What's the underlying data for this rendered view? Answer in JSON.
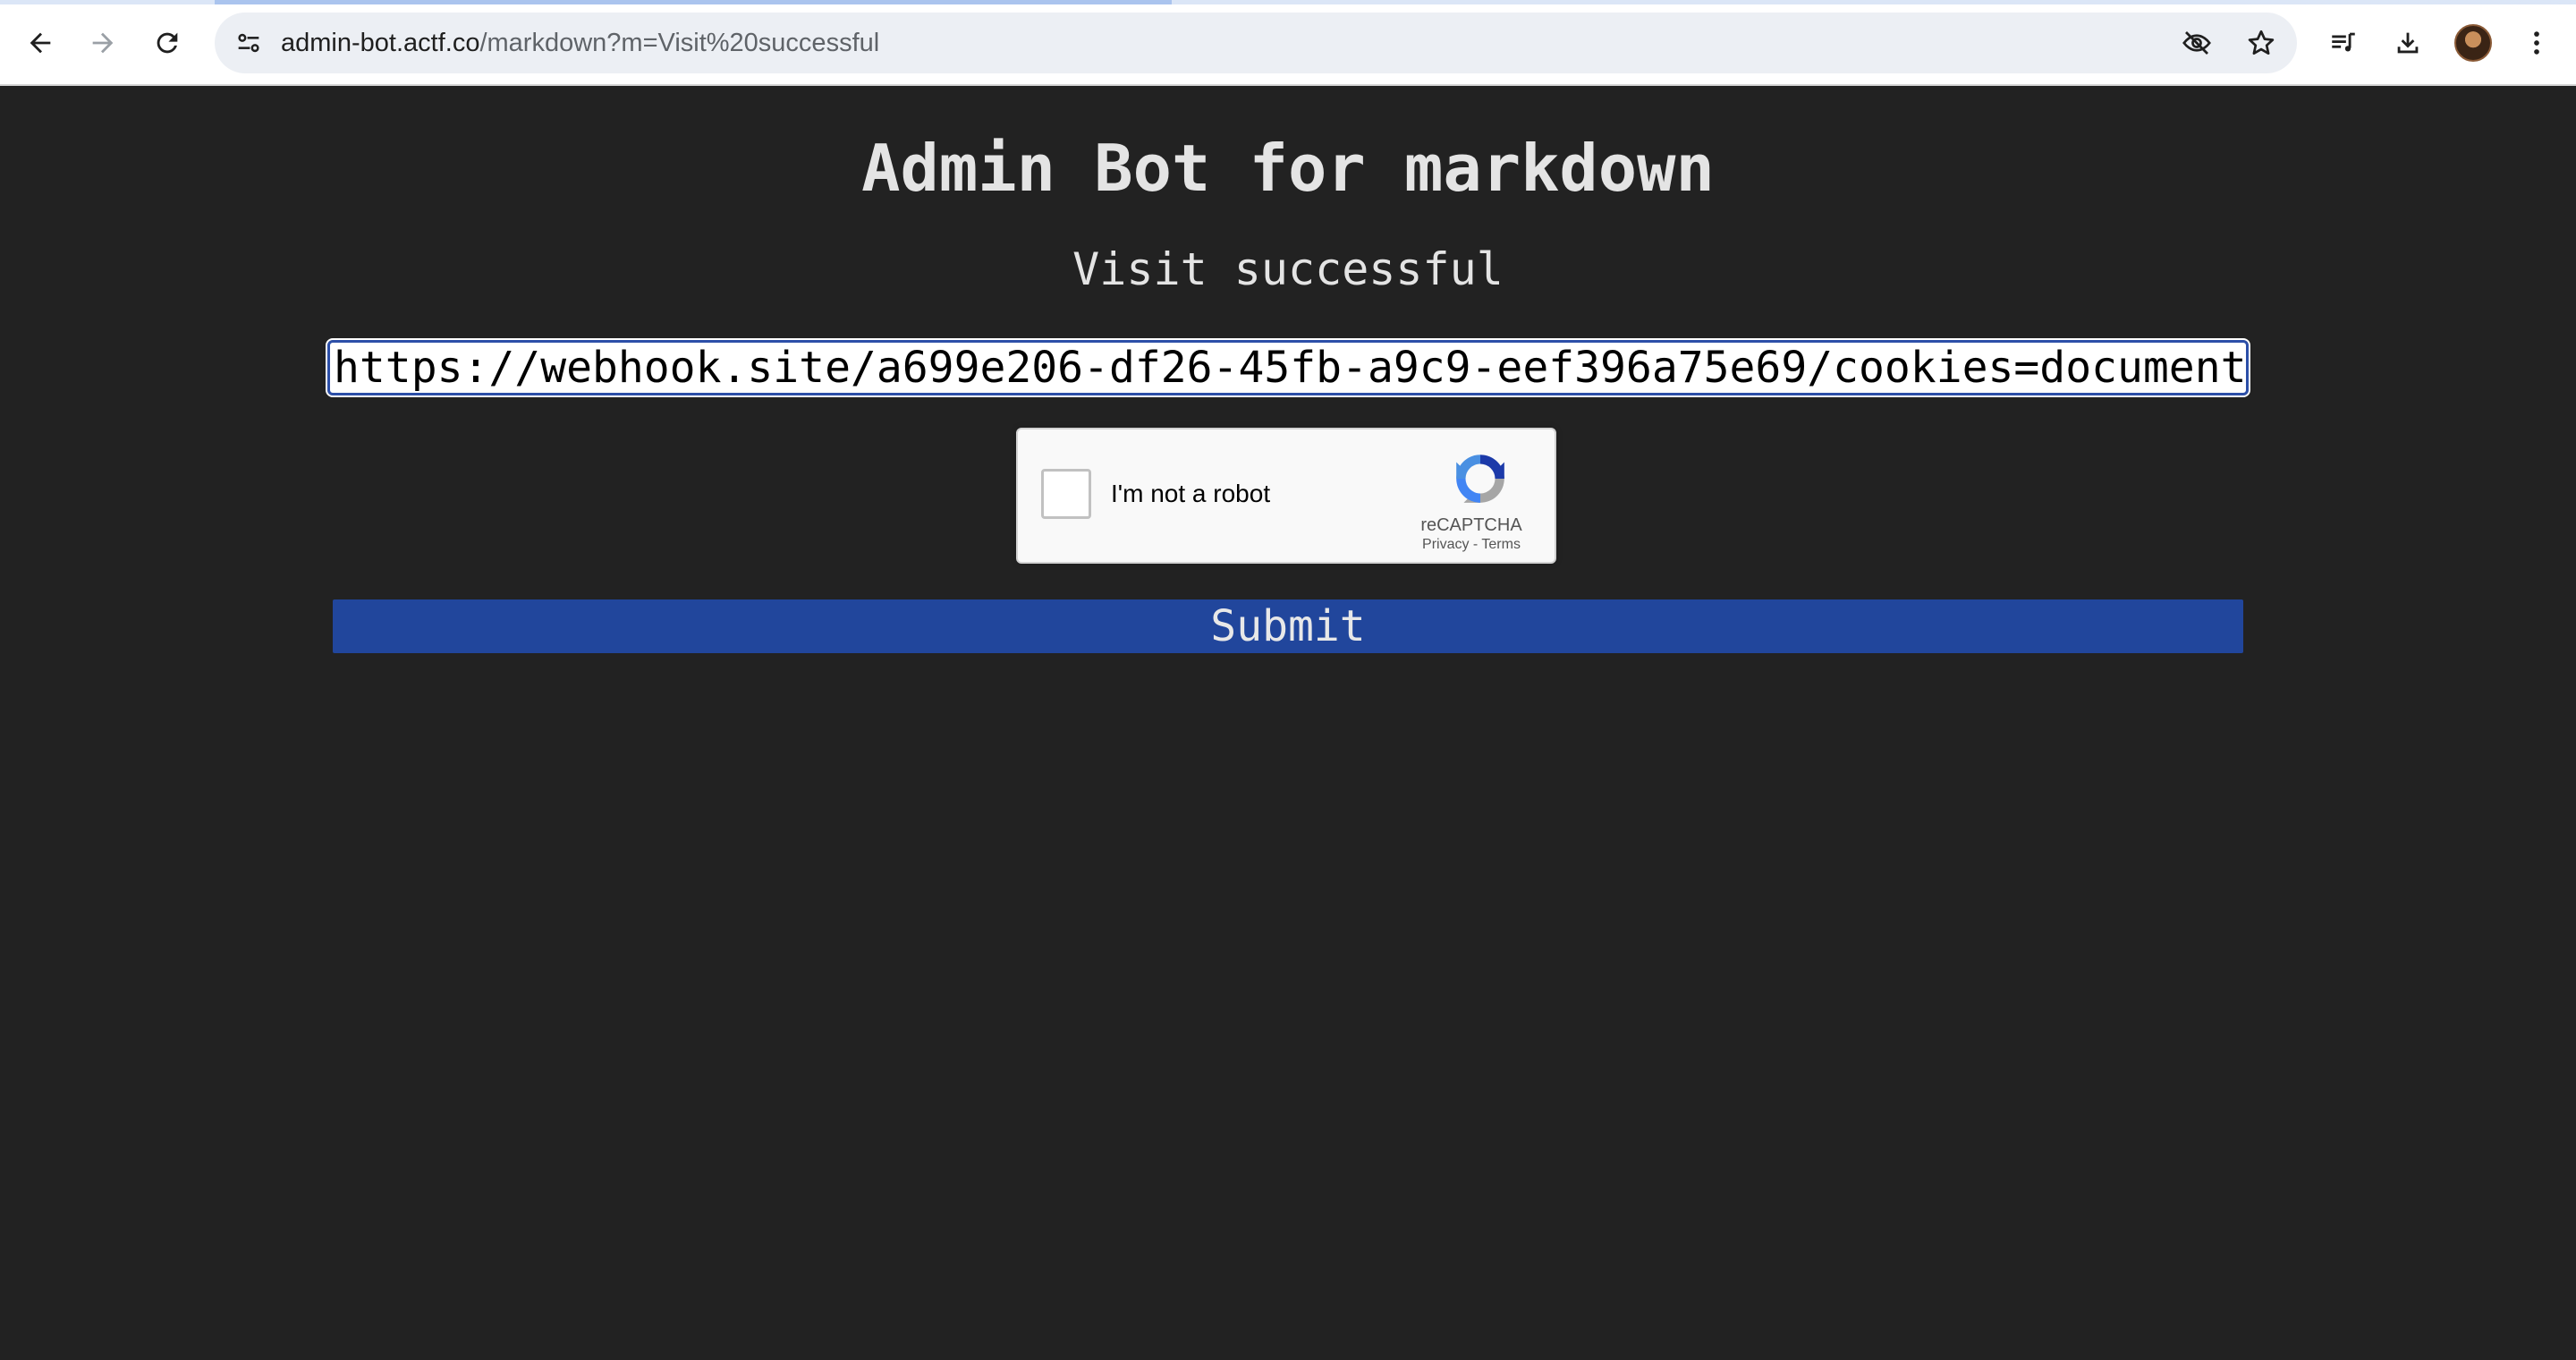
{
  "browser": {
    "url_host": "admin-bot.actf.co",
    "url_path": "/markdown?m=Visit%20successful",
    "icons": {
      "back": "arrow-left-icon",
      "forward": "arrow-right-icon",
      "reload": "reload-icon",
      "site_info": "tune-icon",
      "eye_off": "eye-off-icon",
      "bookmark": "star-icon",
      "media": "playlist-icon",
      "download": "download-icon",
      "menu": "more-vert-icon"
    }
  },
  "page": {
    "title": "Admin Bot for markdown",
    "message": "Visit successful",
    "url_input_value": "https://webhook.site/a699e206-df26-45fb-a9c9-eef396a75e69/cookies=document",
    "submit_label": "Submit"
  },
  "recaptcha": {
    "label": "I'm not a robot",
    "brand": "reCAPTCHA",
    "privacy": "Privacy",
    "separator": "-",
    "terms": "Terms"
  },
  "colors": {
    "page_background": "#222222",
    "text": "#e4e4e4",
    "submit_background": "#21469c",
    "input_border": "#2c4fa8"
  }
}
